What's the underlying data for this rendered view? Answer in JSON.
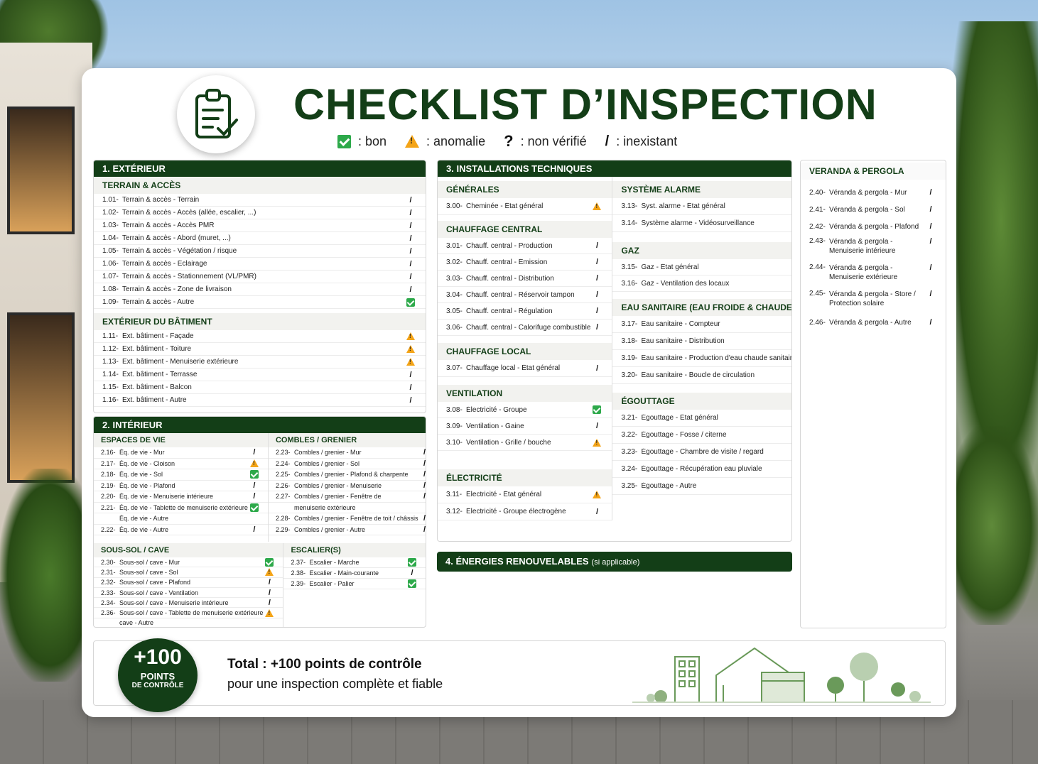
{
  "title": "CHECKLIST D’INSPECTION",
  "legend": [
    {
      "icon": "ok",
      "label": ": bon"
    },
    {
      "icon": "warn",
      "label": ": anomalie"
    },
    {
      "icon": "question",
      "symbol": "?",
      "label": ": non vérifié"
    },
    {
      "icon": "na",
      "symbol": "/",
      "label": ": inexistant"
    }
  ],
  "exterieur": {
    "title": "1. EXTÉRIEUR",
    "terrain": {
      "title": "TERRAIN & ACCÈS",
      "items": [
        {
          "num": "1.01-",
          "label": "Terrain & accès - Terrain",
          "status": "na"
        },
        {
          "num": "1.02-",
          "label": "Terrain & accès - Accès (allée, escalier, ...)",
          "status": "na"
        },
        {
          "num": "1.03-",
          "label": "Terrain & accès - Accès PMR",
          "status": "na"
        },
        {
          "num": "1.04-",
          "label": "Terrain & accès - Abord (muret, ...)",
          "status": "na"
        },
        {
          "num": "1.05-",
          "label": "Terrain & accès - Végétation / risque",
          "status": "na"
        },
        {
          "num": "1.06-",
          "label": "Terrain & accès - Éclairage",
          "status": "na"
        },
        {
          "num": "1.07-",
          "label": "Terrain & accès - Stationnement (VL/PMR)",
          "status": "na"
        },
        {
          "num": "1.08-",
          "label": "Terrain & accès - Zone de livraison",
          "status": "na"
        },
        {
          "num": "1.09-",
          "label": "Terrain & accès - Autre",
          "status": "ok"
        }
      ]
    },
    "batiment": {
      "title": "EXTÉRIEUR DU BÂTIMENT",
      "items": [
        {
          "num": "1.11-",
          "label": "Ext. bâtiment - Façade",
          "status": "warn"
        },
        {
          "num": "1.12-",
          "label": "Ext. bâtiment - Toiture",
          "status": "warn"
        },
        {
          "num": "1.13-",
          "label": "Ext. bâtiment - Menuiserie extérieure",
          "status": "warn"
        },
        {
          "num": "1.14-",
          "label": "Ext. bâtiment - Terrasse",
          "status": "na"
        },
        {
          "num": "1.15-",
          "label": "Ext. bâtiment - Balcon",
          "status": "na"
        },
        {
          "num": "1.16-",
          "label": "Ext. bâtiment - Autre",
          "status": "na"
        }
      ]
    }
  },
  "interieur": {
    "title": "2. INTÉRIEUR",
    "espaces": {
      "title": "ESPACES DE VIE",
      "items": [
        {
          "num": "2.16-",
          "label": "Éq. de vie - Mur",
          "status": "na"
        },
        {
          "num": "2.17-",
          "label": "Éq. de vie - Cloison",
          "status": "warn"
        },
        {
          "num": "2.18-",
          "label": "Éq. de vie - Sol",
          "status": "ok"
        },
        {
          "num": "2.19-",
          "label": "Éq. de vie - Plafond",
          "status": "na"
        },
        {
          "num": "2.20-",
          "label": "Éq. de vie - Menuiserie intérieure",
          "status": "na"
        },
        {
          "num": "2.21-",
          "label": "Éq. de vie - Tablette de menuiserie extérieure",
          "status": "ok"
        },
        {
          "num": "",
          "label": "Éq. de vie - Autre",
          "status": ""
        },
        {
          "num": "2.22-",
          "label": "Éq. de vie - Autre",
          "status": "na"
        }
      ]
    },
    "combles": {
      "title": "COMBLES / GRENIER",
      "items": [
        {
          "num": "2.23-",
          "label": "Combles / grenier - Mur",
          "status": "na"
        },
        {
          "num": "2.24-",
          "label": "Combles / grenier - Sol",
          "status": "na"
        },
        {
          "num": "2.25-",
          "label": "Combles / grenier - Plafond & charpente",
          "status": "na"
        },
        {
          "num": "2.26-",
          "label": "Combles / grenier - Menuiserie",
          "status": "na"
        },
        {
          "num": "2.27-",
          "label": "Combles / grenier - Fenêtre de",
          "status": "na"
        },
        {
          "num": "",
          "label": "menuiserie extérieure",
          "status": ""
        },
        {
          "num": "2.28-",
          "label": "Combles / grenier - Fenêtre de toit / châssis",
          "status": "na"
        },
        {
          "num": "2.29-",
          "label": "Combles / grenier - Autre",
          "status": "na"
        }
      ]
    },
    "soussol": {
      "title": "SOUS-SOL / CAVE",
      "items": [
        {
          "num": "2.30-",
          "label": "Sous-sol / cave - Mur",
          "status": "ok"
        },
        {
          "num": "2.31-",
          "label": "Sous-sol / cave - Sol",
          "status": "warn"
        },
        {
          "num": "2.32-",
          "label": "Sous-sol / cave - Plafond",
          "status": "na"
        },
        {
          "num": "2.33-",
          "label": "Sous-sol / cave - Ventilation",
          "status": "na"
        },
        {
          "num": "2.34-",
          "label": "Sous-sol / cave - Menuiserie intérieure",
          "status": "na"
        },
        {
          "num": "2.36-",
          "label": "Sous-sol / cave - Tablette de menuiserie extérieure",
          "status": "warn"
        },
        {
          "num": "",
          "label": "cave - Autre",
          "status": ""
        }
      ]
    },
    "escaliers": {
      "title": "ESCALIER(S)",
      "items": [
        {
          "num": "2.37-",
          "label": "Escalier - Marche",
          "status": "ok"
        },
        {
          "num": "2.38-",
          "label": "Escalier - Main-courante",
          "status": "na"
        },
        {
          "num": "2.39-",
          "label": "Escalier - Palier",
          "status": "ok"
        }
      ]
    }
  },
  "installations": {
    "title": "3. INSTALLATIONS TECHNIQUES",
    "generales": {
      "title": "GÉNÉRALES",
      "items": [
        {
          "num": "3.00-",
          "label": "Cheminée - État général",
          "status": "warn"
        }
      ]
    },
    "chauffage_central": {
      "title": "CHAUFFAGE CENTRAL",
      "items": [
        {
          "num": "3.01-",
          "label": "Chauff. central - Production",
          "status": "na"
        },
        {
          "num": "3.02-",
          "label": "Chauff. central - Émission",
          "status": "na"
        },
        {
          "num": "3.03-",
          "label": "Chauff. central - Distribution",
          "status": "na"
        },
        {
          "num": "3.04-",
          "label": "Chauff. central - Réservoir tampon",
          "status": "na"
        },
        {
          "num": "3.05-",
          "label": "Chauff. central - Régulation",
          "status": "na"
        },
        {
          "num": "3.06-",
          "label": "Chauff. central - Calorifuge combustible",
          "status": "na"
        }
      ]
    },
    "chauffage_local": {
      "title": "CHAUFFAGE LOCAL",
      "items": [
        {
          "num": "3.07-",
          "label": "Chauffage local - État général",
          "status": "na"
        }
      ]
    },
    "ventilation": {
      "title": "VENTILATION",
      "items": [
        {
          "num": "3.08-",
          "label": "Électricité - Groupe",
          "status": "ok"
        },
        {
          "num": "3.09-",
          "label": "Ventilation - Gaine",
          "status": "na"
        },
        {
          "num": "3.10-",
          "label": "Ventilation - Grille / bouche",
          "status": "warn"
        }
      ]
    },
    "electricite": {
      "title": "ÉLECTRICITÉ",
      "items": [
        {
          "num": "3.11-",
          "label": "Électricité - État général",
          "status": "warn"
        },
        {
          "num": "3.12-",
          "label": "Électricité - Groupe électrogène",
          "status": "na"
        }
      ]
    },
    "alarme": {
      "title": "SYSTÈME ALARME",
      "items": [
        {
          "num": "3.13-",
          "label": "Syst. alarme - État général",
          "status": "na"
        },
        {
          "num": "3.14-",
          "label": "Système alarme - Vidéosurveillance",
          "status": "na"
        }
      ]
    },
    "gaz": {
      "title": "GAZ",
      "items": [
        {
          "num": "3.15-",
          "label": "Gaz - État général",
          "status": "na"
        },
        {
          "num": "3.16-",
          "label": "Gaz - Ventilation des locaux",
          "status": "na"
        }
      ]
    },
    "eau": {
      "title": "EAU SANITAIRE (EAU FROIDE & CHAUDE)",
      "items": [
        {
          "num": "3.17-",
          "label": "Eau sanitaire - Compteur",
          "status": "ok"
        },
        {
          "num": "3.18-",
          "label": "Eau sanitaire - Distribution",
          "status": "warn"
        },
        {
          "num": "3.19-",
          "label": "Eau sanitaire - Production d'eau chaude sanitaire",
          "status": "warn"
        },
        {
          "num": "3.20-",
          "label": "Eau sanitaire - Boucle de circulation",
          "status": "na"
        }
      ]
    },
    "egouttage": {
      "title": "ÉGOUTTAGE",
      "items": [
        {
          "num": "3.21-",
          "label": "Égouttage - État général",
          "status": "ok"
        },
        {
          "num": "3.22-",
          "label": "Égouttage - Fosse / citerne",
          "status": "na"
        },
        {
          "num": "3.23-",
          "label": "Égouttage - Chambre de visite / regard",
          "status": "na"
        },
        {
          "num": "3.24-",
          "label": "Égouttage - Récupération eau pluviale",
          "status": "warn"
        },
        {
          "num": "3.25-",
          "label": "Égouttage - Autre",
          "status": "na"
        }
      ]
    }
  },
  "energies": {
    "title": "4. ÉNERGIES RENOUVELABLES",
    "note": "(si applicable)"
  },
  "veranda": {
    "title": "VERANDA & PERGOLA",
    "items": [
      {
        "num": "2.40-",
        "label": "Véranda & pergola - Mur",
        "status": "na"
      },
      {
        "num": "2.41-",
        "label": "Véranda & pergola - Sol",
        "status": "na"
      },
      {
        "num": "2.42-",
        "label": "Véranda & pergola - Plafond",
        "status": "na"
      },
      {
        "num": "2.43-",
        "label": "Véranda & pergola - Menuiserie intérieure",
        "status": "na"
      },
      {
        "num": "2.44-",
        "label": "Véranda & pergola - Menuiserie extérieure",
        "status": "na"
      },
      {
        "num": "2.45-",
        "label": "Véranda & pergola - Store / Protection solaire",
        "status": "na"
      },
      {
        "num": "2.46-",
        "label": "Véranda & pergola - Autre",
        "status": "na"
      }
    ]
  },
  "footer": {
    "badge_big": "+100",
    "badge_points": "POINTS",
    "badge_sub": "DE CONTRÔLE",
    "line1": "Total : +100 points de contrôle",
    "line2": "pour une inspection complète et fiable"
  },
  "colors": {
    "primary": "#133e17",
    "ok": "#2da94a",
    "warn": "#f4a417"
  }
}
